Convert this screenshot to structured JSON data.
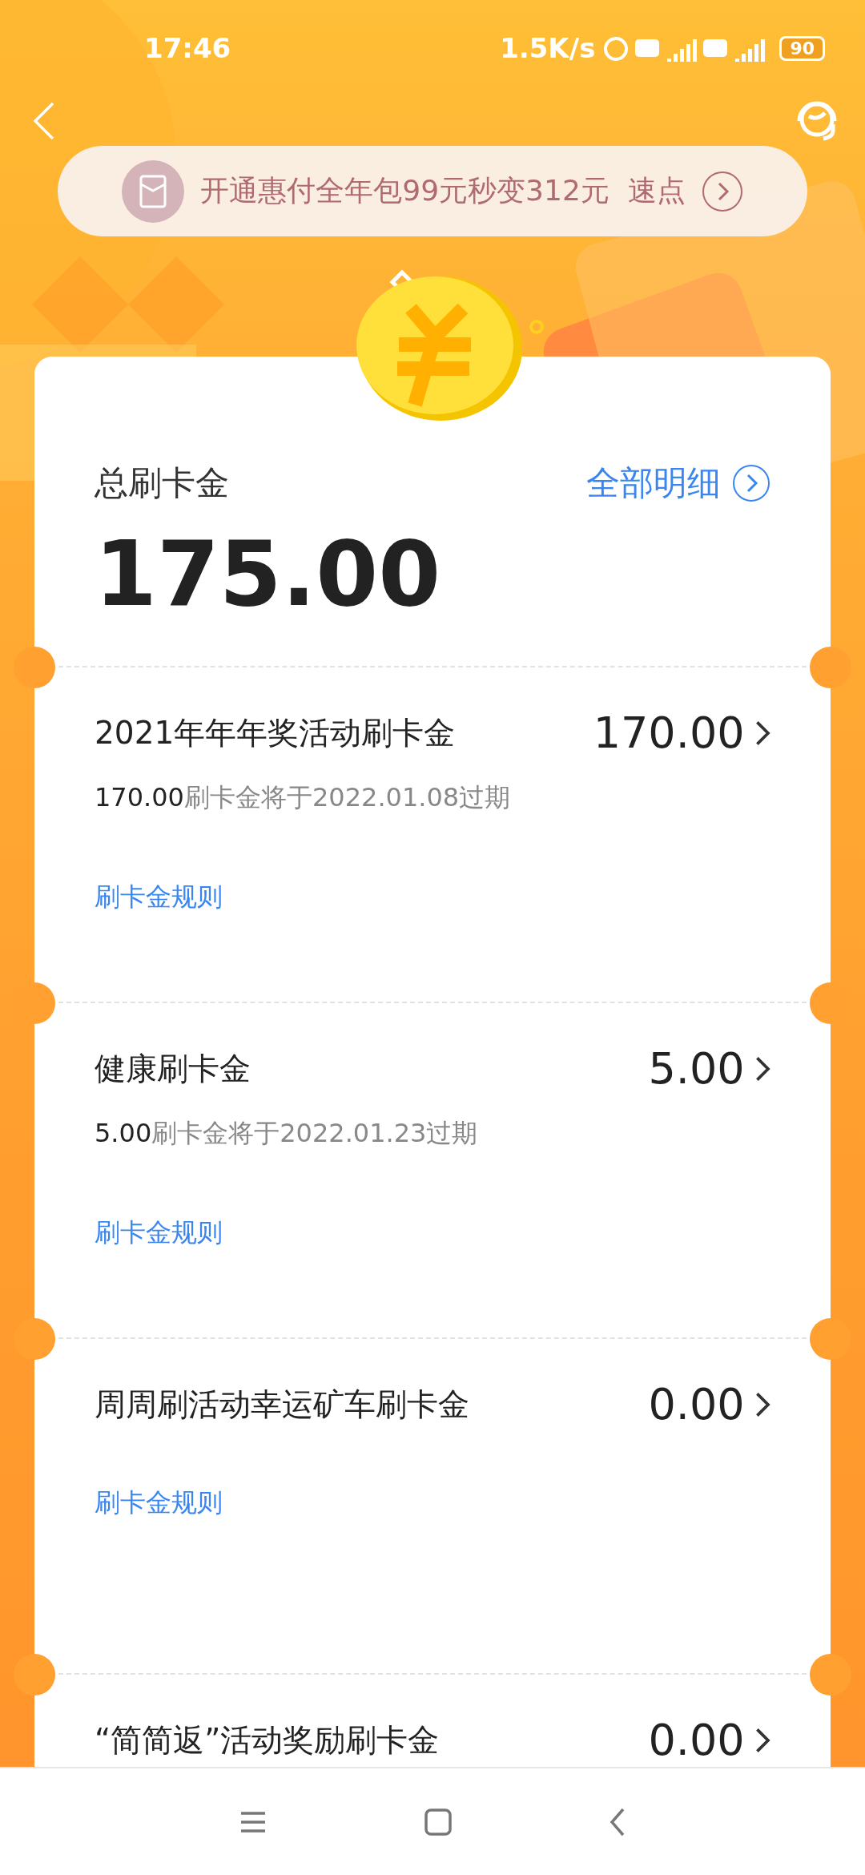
{
  "status_bar": {
    "time": "17:46",
    "speed": "1.5K/s",
    "battery": "90"
  },
  "banner": {
    "text": "开通惠付全年包99元秒变312元  速点"
  },
  "summary": {
    "label": "总刷卡金",
    "amount": "175.00",
    "link": "全部明细"
  },
  "items": [
    {
      "title": "2021年年年奖活动刷卡金",
      "amount": "170.00",
      "expiry_amount": "170.00",
      "expiry_note": "刷卡金将于2022.01.08过期",
      "rule": "刷卡金规则"
    },
    {
      "title": "健康刷卡金",
      "amount": "5.00",
      "expiry_amount": "5.00",
      "expiry_note": "刷卡金将于2022.01.23过期",
      "rule": "刷卡金规则"
    },
    {
      "title": "周周刷活动幸运矿车刷卡金",
      "amount": "0.00",
      "rule": "刷卡金规则"
    },
    {
      "title": "“简简返”活动奖励刷卡金",
      "amount": "0.00"
    }
  ]
}
